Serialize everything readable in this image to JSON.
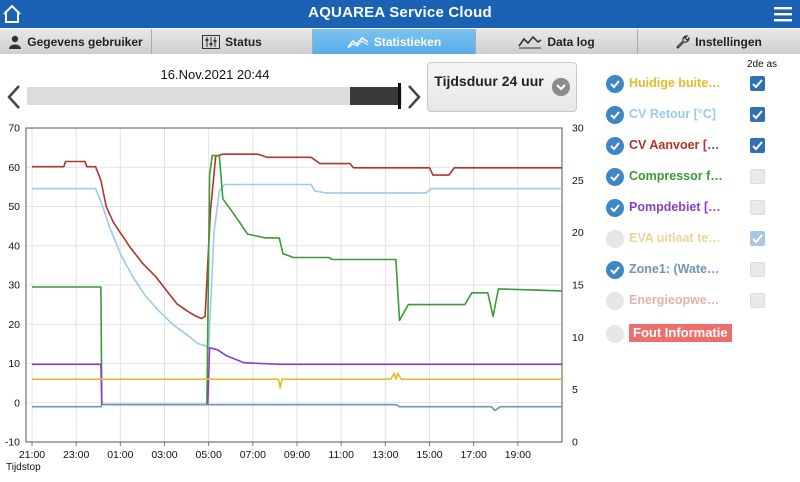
{
  "app": {
    "title": "AQUAREA Service Cloud"
  },
  "icons": {
    "home": "home-icon",
    "menu": "hamburger-menu-icon",
    "user": "user-icon",
    "status": "status-sliders-icon",
    "stats": "chart-line-icon",
    "datalog": "datalog-icon",
    "settings": "wrench-icon"
  },
  "tabs": [
    {
      "label": "Gegevens gebruiker",
      "active": false
    },
    {
      "label": "Status",
      "active": false
    },
    {
      "label": "Statistieken",
      "active": true
    },
    {
      "label": "Data log",
      "active": false
    },
    {
      "label": "Instellingen",
      "active": false
    }
  ],
  "timeline": {
    "date": "16.Nov.2021 20:44",
    "position": 0.86
  },
  "duration": {
    "label": "Tijdsduur 24 uur"
  },
  "legend": {
    "second_axis_header": "2de as",
    "items": [
      {
        "label": "Huidige buite…",
        "color": "#e0bd2d",
        "enabled": true,
        "second_axis": "on"
      },
      {
        "label": "CV Retour [°C]",
        "color": "#9ccbe9",
        "enabled": true,
        "second_axis": "on"
      },
      {
        "label": "CV Aanvoer […",
        "color": "#b2342b",
        "enabled": true,
        "second_axis": "on"
      },
      {
        "label": "Compressor f…",
        "color": "#3c9a36",
        "enabled": true,
        "second_axis": "off"
      },
      {
        "label": "Pompdebiet […",
        "color": "#8b3fc8",
        "enabled": true,
        "second_axis": "off"
      },
      {
        "label": "EVA uitlaat te…",
        "color": "#e9d49a",
        "enabled": false,
        "second_axis": "dim"
      },
      {
        "label": "Zone1: (Wate…",
        "color": "#6e95b4",
        "enabled": true,
        "second_axis": "off"
      },
      {
        "label": "Energieopwe…",
        "color": "#e3b3ae",
        "enabled": false,
        "second_axis": "off"
      }
    ],
    "fout": {
      "label": "Fout Informatie",
      "color": "#ee6e6b"
    }
  },
  "chart_data": {
    "type": "line",
    "xlabel": "Tijdstop",
    "x_tick_labels": [
      "21:00",
      "23:00",
      "01:00",
      "03:00",
      "05:00",
      "07:00",
      "09:00",
      "11:00",
      "13:00",
      "15:00",
      "17:00",
      "19:00"
    ],
    "y_left": {
      "range": [
        -10,
        70
      ],
      "ticks": [
        -10,
        0,
        10,
        20,
        30,
        40,
        50,
        60,
        70
      ]
    },
    "y_right": {
      "range": [
        0,
        30
      ],
      "ticks": [
        0,
        5,
        10,
        15,
        20,
        25,
        30
      ]
    },
    "grid": true,
    "series": [
      {
        "name": "CV Aanvoer […",
        "color": "#b2342b",
        "axis": "right",
        "points": [
          [
            0,
            26.3
          ],
          [
            1.8,
            26.3
          ],
          [
            1.9,
            26.8
          ],
          [
            3,
            26.8
          ],
          [
            3.1,
            26.3
          ],
          [
            3.6,
            26.3
          ],
          [
            3.9,
            25
          ],
          [
            4.2,
            22.5
          ],
          [
            4.6,
            21
          ],
          [
            5,
            20
          ],
          [
            5.6,
            18.5
          ],
          [
            6.3,
            17
          ],
          [
            7,
            15.8
          ],
          [
            7.6,
            14.5
          ],
          [
            8.2,
            13.2
          ],
          [
            8.8,
            12.5
          ],
          [
            9.3,
            12
          ],
          [
            9.6,
            11.8
          ],
          [
            9.8,
            12
          ],
          [
            10.1,
            22
          ],
          [
            10.4,
            27.3
          ],
          [
            10.8,
            27.5
          ],
          [
            12.8,
            27.5
          ],
          [
            13.3,
            27.2
          ],
          [
            15.8,
            27.2
          ],
          [
            16.3,
            26.6
          ],
          [
            18,
            26.6
          ],
          [
            18.2,
            26.2
          ],
          [
            22.5,
            26.2
          ],
          [
            22.7,
            25.5
          ],
          [
            23.6,
            25.5
          ],
          [
            23.9,
            26.2
          ],
          [
            30,
            26.2
          ]
        ]
      },
      {
        "name": "CV Retour [°C]",
        "color": "#9ccbe9",
        "axis": "right",
        "points": [
          [
            0,
            24.2
          ],
          [
            3.6,
            24.2
          ],
          [
            3.9,
            23
          ],
          [
            4.4,
            20.5
          ],
          [
            5,
            18
          ],
          [
            5.7,
            15.8
          ],
          [
            6.4,
            14
          ],
          [
            7.2,
            12.5
          ],
          [
            8,
            11.2
          ],
          [
            8.8,
            10.2
          ],
          [
            9.4,
            9.4
          ],
          [
            9.8,
            9.2
          ],
          [
            10,
            9
          ],
          [
            10.3,
            20
          ],
          [
            10.6,
            24
          ],
          [
            10.9,
            24.6
          ],
          [
            15.8,
            24.6
          ],
          [
            16,
            24
          ],
          [
            16.6,
            23.8
          ],
          [
            22.3,
            23.8
          ],
          [
            22.6,
            24.2
          ],
          [
            30,
            24.2
          ]
        ]
      },
      {
        "name": "Compressor f…",
        "color": "#3c9a36",
        "axis": "left",
        "points": [
          [
            0,
            29.5
          ],
          [
            3.9,
            29.5
          ],
          [
            3.95,
            -0.5
          ],
          [
            9.9,
            -0.5
          ],
          [
            10.05,
            58
          ],
          [
            10.2,
            63
          ],
          [
            10.6,
            63
          ],
          [
            10.8,
            52
          ],
          [
            11.6,
            47
          ],
          [
            12.2,
            43
          ],
          [
            13.2,
            42
          ],
          [
            14,
            42
          ],
          [
            14.2,
            38
          ],
          [
            14.8,
            37
          ],
          [
            16.8,
            37
          ],
          [
            17,
            36.5
          ],
          [
            20.6,
            36.5
          ],
          [
            20.8,
            21
          ],
          [
            21.3,
            25
          ],
          [
            24.5,
            25
          ],
          [
            24.9,
            28
          ],
          [
            25.8,
            28
          ],
          [
            26.1,
            22
          ],
          [
            26.4,
            29
          ],
          [
            30,
            28.5
          ]
        ]
      },
      {
        "name": "Pompdebiet […",
        "color": "#8b3fc8",
        "axis": "left",
        "points": [
          [
            0,
            9.8
          ],
          [
            3.9,
            9.8
          ],
          [
            3.95,
            -0.5
          ],
          [
            9.95,
            -0.5
          ],
          [
            10.05,
            14
          ],
          [
            10.5,
            13.5
          ],
          [
            11,
            12
          ],
          [
            12,
            10.2
          ],
          [
            14,
            9.8
          ],
          [
            30,
            9.8
          ]
        ]
      },
      {
        "name": "Huidige buite…",
        "color": "#e0bd2d",
        "axis": "left",
        "points": [
          [
            0,
            6
          ],
          [
            13.95,
            6
          ],
          [
            14.05,
            3.8
          ],
          [
            14.15,
            6
          ],
          [
            20.3,
            6
          ],
          [
            20.5,
            7.5
          ],
          [
            20.6,
            6
          ],
          [
            20.7,
            7.5
          ],
          [
            20.9,
            6
          ],
          [
            30,
            6
          ]
        ]
      },
      {
        "name": "Zone1: (Wate…",
        "color": "#6e95b4",
        "axis": "left",
        "points": [
          [
            0,
            -1
          ],
          [
            3.9,
            -1
          ],
          [
            3.95,
            -0.5
          ],
          [
            20.6,
            -0.5
          ],
          [
            20.8,
            -1
          ],
          [
            26,
            -1
          ],
          [
            26.2,
            -2
          ],
          [
            26.5,
            -1
          ],
          [
            30,
            -1
          ]
        ]
      }
    ]
  }
}
